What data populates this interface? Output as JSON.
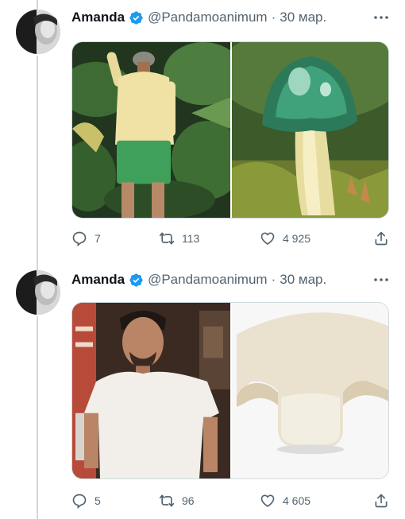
{
  "tweets": [
    {
      "author_name": "Amanda",
      "author_handle": "@Pandamoanimum",
      "separator": "·",
      "date": "30 мар.",
      "replies": "7",
      "retweets": "113",
      "likes": "4 925"
    },
    {
      "author_name": "Amanda",
      "author_handle": "@Pandamoanimum",
      "separator": "·",
      "date": "30 мар.",
      "replies": "5",
      "retweets": "96",
      "likes": "4 605"
    }
  ],
  "colors": {
    "verified_badge": "#1d9bf0",
    "secondary_text": "#536471",
    "thread_line": "#cfd9de"
  },
  "icons": [
    "verified-badge-icon",
    "more-icon",
    "reply-icon",
    "retweet-icon",
    "like-icon",
    "share-icon"
  ]
}
